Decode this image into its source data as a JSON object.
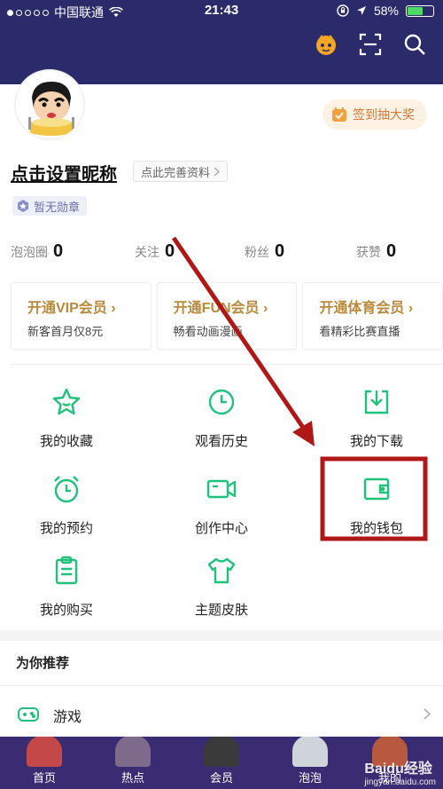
{
  "status_bar": {
    "carrier": "中国联通",
    "time": "21:43",
    "battery": "58%",
    "battery_level": 0.58
  },
  "header": {
    "icons": [
      "mascot-icon",
      "scan-icon",
      "search-icon"
    ]
  },
  "profile": {
    "nickname": "点击设置昵称",
    "complete_profile": "点此完善资料",
    "badge": "暂无勋章",
    "signin": "签到抽大奖"
  },
  "stats": [
    {
      "label": "泡泡圈",
      "value": "0"
    },
    {
      "label": "关注",
      "value": "0"
    },
    {
      "label": "粉丝",
      "value": "0"
    },
    {
      "label": "获赞",
      "value": "0"
    }
  ],
  "vip_cards": [
    {
      "title": "开通VIP会员",
      "subtitle": "新客首月仅8元"
    },
    {
      "title": "开通FUN会员",
      "subtitle": "畅看动画漫画"
    },
    {
      "title": "开通体育会员",
      "subtitle": "看精彩比赛直播"
    }
  ],
  "grid": [
    {
      "label": "我的收藏",
      "icon": "star-icon"
    },
    {
      "label": "观看历史",
      "icon": "clock-icon"
    },
    {
      "label": "我的下载",
      "icon": "download-icon"
    },
    {
      "label": "我的预约",
      "icon": "alarm-icon"
    },
    {
      "label": "创作中心",
      "icon": "video-camera-icon"
    },
    {
      "label": "我的钱包",
      "icon": "wallet-icon"
    },
    {
      "label": "我的购买",
      "icon": "clipboard-icon"
    },
    {
      "label": "主题皮肤",
      "icon": "tshirt-icon"
    }
  ],
  "recommend": {
    "title": "为你推荐",
    "items": [
      {
        "label": "游戏",
        "icon": "gamepad-icon"
      }
    ]
  },
  "tabbar": [
    {
      "label": "首页"
    },
    {
      "label": "热点"
    },
    {
      "label": "会员"
    },
    {
      "label": "泡泡"
    },
    {
      "label": "我的"
    }
  ],
  "watermark": {
    "brand": "Baidu经验",
    "url": "jingyan.baidu.com"
  },
  "colors": {
    "header_bg": "#2b2a6b",
    "accent_green": "#1fc27a",
    "vip_gold": "#b98a3c",
    "highlight_red": "#b01818"
  }
}
